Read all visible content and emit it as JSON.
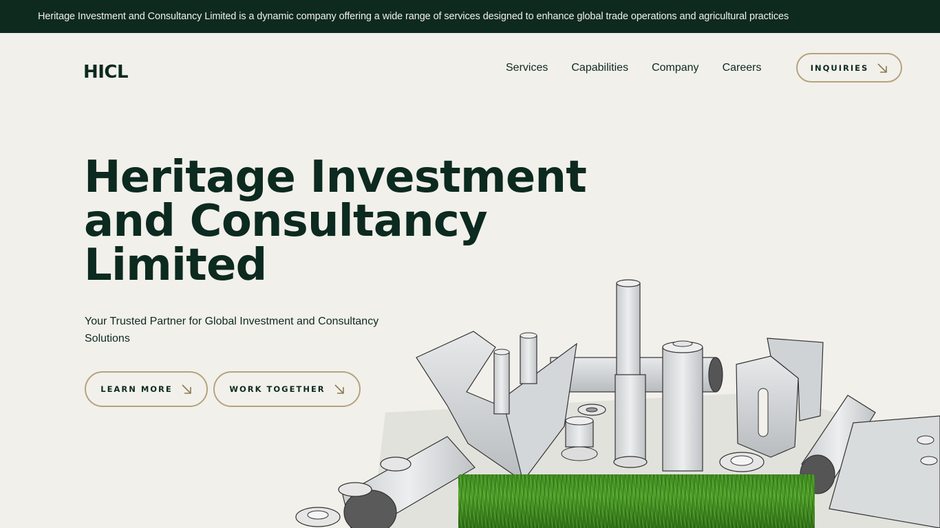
{
  "announcement": "Heritage Investment and Consultancy Limited is a dynamic company offering a wide range of services designed to enhance global trade operations and agricultural practices",
  "brand": {
    "logo": "HICL"
  },
  "nav": {
    "items": [
      {
        "label": "Services"
      },
      {
        "label": "Capabilities"
      },
      {
        "label": "Company"
      },
      {
        "label": "Careers"
      }
    ],
    "cta": {
      "label": "INQUIRIES",
      "icon": "arrow-down-right-icon"
    }
  },
  "hero": {
    "title_lines": [
      "Heritage Investment",
      "and Consultancy",
      "Limited"
    ],
    "subtitle": "Your Trusted Partner for Global Investment and Consultancy Solutions",
    "buttons": [
      {
        "label": "LEARN MORE",
        "icon": "arrow-down-right-icon"
      },
      {
        "label": "WORK TOGETHER",
        "icon": "arrow-down-right-icon"
      }
    ]
  },
  "colors": {
    "background": "#f2f0eb",
    "topbar": "#0e2a1f",
    "text": "#0c2a1f",
    "button_border": "#b4a37e",
    "arrow": "#8a7a52"
  }
}
